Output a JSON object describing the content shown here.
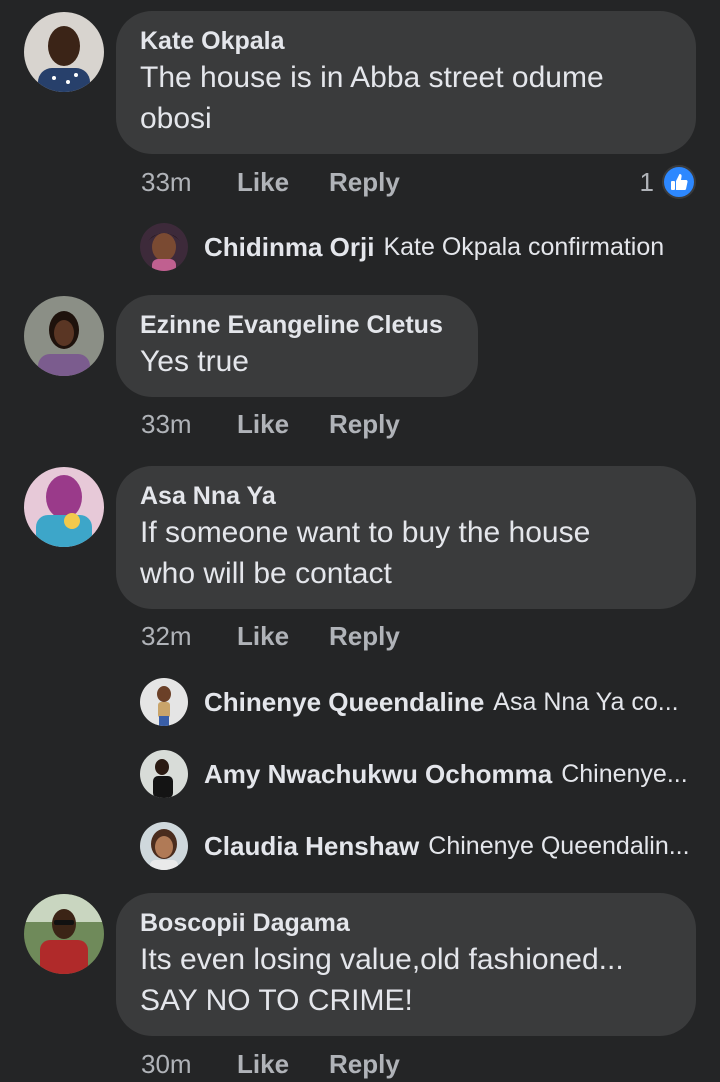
{
  "comments": [
    {
      "name": "Kate Okpala",
      "text_lines": [
        "The house is in Abba street odume",
        "obosi"
      ],
      "time": "33m",
      "like_label": "Like",
      "reply_label": "Reply",
      "reaction_count": "1",
      "replies": [
        {
          "name": "Chidinma Orji",
          "preview": "Kate Okpala confirmation"
        }
      ]
    },
    {
      "name": "Ezinne Evangeline Cletus",
      "text_lines": [
        "Yes true"
      ],
      "time": "33m",
      "like_label": "Like",
      "reply_label": "Reply"
    },
    {
      "name": "Asa Nna Ya",
      "text_lines": [
        "If someone want to buy the house",
        "who will be contact"
      ],
      "time": "32m",
      "like_label": "Like",
      "reply_label": "Reply",
      "replies": [
        {
          "name": "Chinenye Queendaline",
          "preview": "Asa Nna Ya co..."
        },
        {
          "name": "Amy Nwachukwu Ochomma",
          "preview": "Chinenye..."
        },
        {
          "name": "Claudia Henshaw",
          "preview": "Chinenye Queendalin..."
        }
      ]
    },
    {
      "name": "Boscopii Dagama",
      "text_lines": [
        "Its even losing value,old fashioned...",
        "SAY NO TO CRIME!"
      ],
      "time": "30m",
      "like_label": "Like",
      "reply_label": "Reply"
    }
  ],
  "colors": {
    "background": "#242526",
    "bubble": "#3a3b3c",
    "text_primary": "#e4e6eb",
    "text_secondary": "#b0b3b8",
    "like_badge": "#2d88ff"
  },
  "icons": {
    "reaction": "thumbs-up-icon"
  }
}
